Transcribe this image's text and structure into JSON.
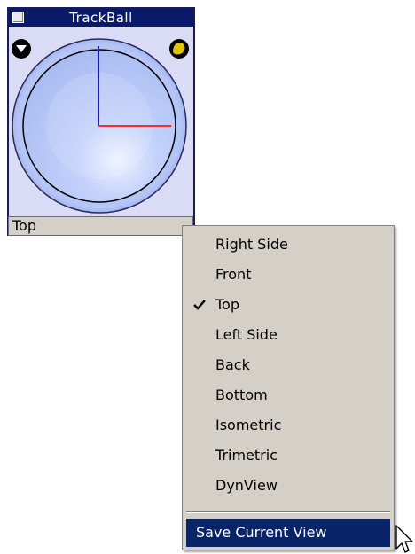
{
  "trackball": {
    "title": "TrackBall",
    "view_value": "Top"
  },
  "view_menu": {
    "items": [
      {
        "label": "Right Side",
        "checked": false
      },
      {
        "label": "Front",
        "checked": false
      },
      {
        "label": "Top",
        "checked": true
      },
      {
        "label": "Left Side",
        "checked": false
      },
      {
        "label": "Back",
        "checked": false
      },
      {
        "label": "Bottom",
        "checked": false
      },
      {
        "label": "Isometric",
        "checked": false
      },
      {
        "label": "Trimetric",
        "checked": false
      },
      {
        "label": "DynView",
        "checked": false
      }
    ],
    "highlighted_item": {
      "label": "Save Current View"
    }
  },
  "colors": {
    "titlebar": "#0a1a6a",
    "menu_background": "#d4d0c8",
    "menu_highlight": "#0a246a",
    "sphere_outer": "#9fb3ee",
    "sphere_inner": "#c3d1fb",
    "axis_red": "#ff2b2b",
    "axis_blue": "#1818c8",
    "icon_yellow": "#e2c400"
  },
  "icons": {
    "window": "system-menu-icon",
    "left_corner": "down-triangle-icon",
    "right_corner": "yellow-blob-icon",
    "checkmark": "checkmark-icon",
    "cursor": "mouse-pointer-icon"
  }
}
